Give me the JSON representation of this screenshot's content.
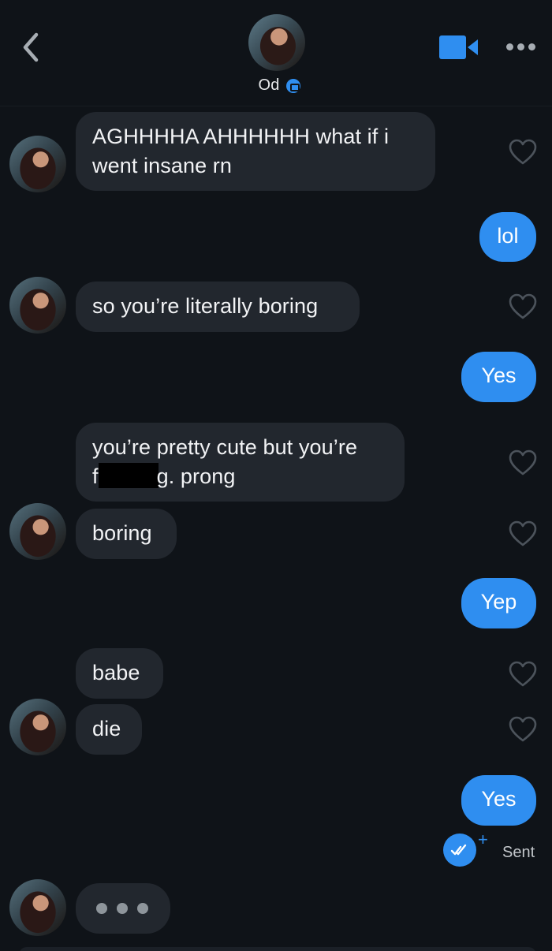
{
  "header": {
    "contact_name": "Od",
    "back_icon": "chevron-left-icon",
    "video_icon": "video-camera-icon",
    "more_icon": "more-horizontal-icon",
    "accent_color": "#2f8ef0"
  },
  "messages": [
    {
      "sender": "them",
      "lines": [
        "AGHHHHA AHHHHHH what if i",
        "went insane rn"
      ]
    },
    {
      "sender": "me",
      "text": "lol"
    },
    {
      "sender": "them",
      "text": "so you’re literally boring"
    },
    {
      "sender": "me",
      "text": "Yes"
    },
    {
      "sender": "them",
      "line1": "you’re pretty cute but you’re",
      "line2_start": "f",
      "line2_end": "g. prong"
    },
    {
      "sender": "them",
      "text": "boring"
    },
    {
      "sender": "me",
      "text": "Yep"
    },
    {
      "sender": "them",
      "text": "babe"
    },
    {
      "sender": "them",
      "text": "die"
    },
    {
      "sender": "me",
      "text": "Yes"
    }
  ],
  "status": {
    "sent_label": "Sent",
    "read_icon": "double-check-icon"
  },
  "typing_indicator": {
    "visible": true
  }
}
